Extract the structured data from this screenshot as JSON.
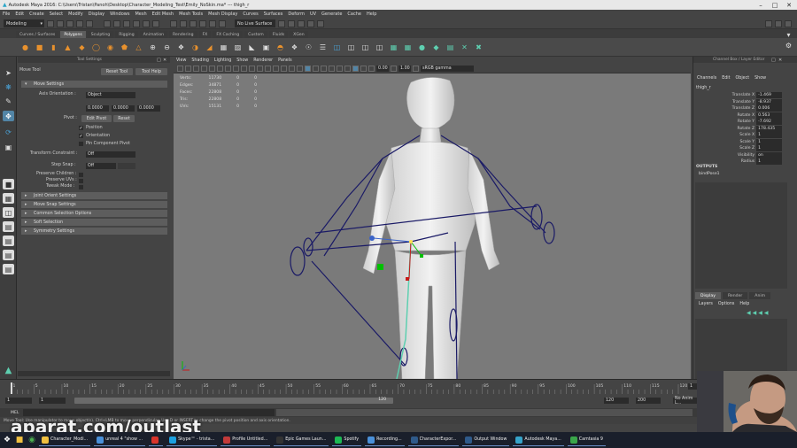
{
  "window": {
    "title": "Autodesk Maya 2016: C:\\Users\\Tristan\\Panoh\\Desktop\\Character_Modeling_Test\\Emily_NoSkin.ma*  ---  thigh_r"
  },
  "menu": [
    "File",
    "Edit",
    "Create",
    "Select",
    "Modify",
    "Display",
    "Windows",
    "Mesh",
    "Edit Mesh",
    "Mesh Tools",
    "Mesh Display",
    "Curves",
    "Surfaces",
    "Deform",
    "UV",
    "Generate",
    "Cache",
    "Help"
  ],
  "statusline": {
    "mode": "Modeling",
    "live_surface": "No Live Surface"
  },
  "shelf_tabs": [
    "Curves / Surfaces",
    "Polygons",
    "Sculpting",
    "Rigging",
    "Animation",
    "Rendering",
    "FX",
    "FX Caching",
    "Custom",
    "Fluids",
    "XGen"
  ],
  "shelf_active": "Polygons",
  "tool_settings": {
    "panel_title": "Tool Settings",
    "tool_name": "Move Tool",
    "reset_button": "Reset Tool",
    "help_button": "Tool Help",
    "move_settings": "Move Settings",
    "axis_orientation_label": "Axis Orientation :",
    "axis_orientation_value": "Object",
    "coord_x": "0.0000",
    "coord_y": "0.0000",
    "coord_z": "0.0000",
    "pivot_label": "Pivot :",
    "edit_pivot": "Edit Pivot",
    "pivot_reset": "Reset",
    "position": "Position",
    "orientation": "Orientation",
    "pin_pivot": "Pin Component Pivot",
    "transform_constraint_label": "Transform Constraint :",
    "transform_constraint_value": "Off",
    "step_snap_label": "Step Snap :",
    "step_snap_value": "Off",
    "preserve_children": "Preserve Children :",
    "preserve_uvs": "Preserve UVs :",
    "tweak_mode": "Tweak Mode :",
    "sections": [
      "Joint Orient Settings",
      "Move Snap Settings",
      "Common Selection Options",
      "Soft Selection",
      "Symmetry Settings"
    ]
  },
  "viewport": {
    "menu": [
      "View",
      "Shading",
      "Lighting",
      "Show",
      "Renderer",
      "Panels"
    ],
    "gamma": "sRGB gamma",
    "exposure": "0.00",
    "gamma_val": "1.00",
    "hud": [
      {
        "label": "Verts:",
        "a": "11730",
        "b": "0",
        "c": "0"
      },
      {
        "label": "Edges:",
        "a": "34871",
        "b": "0",
        "c": "0"
      },
      {
        "label": "Faces:",
        "a": "22808",
        "b": "0",
        "c": "0"
      },
      {
        "label": "Tris:",
        "a": "22808",
        "b": "0",
        "c": "0"
      },
      {
        "label": "UVs:",
        "a": "15131",
        "b": "0",
        "c": "0"
      }
    ]
  },
  "channel_box": {
    "header": "Channel Box / Layer Editor",
    "menu": [
      "Channels",
      "Edit",
      "Object",
      "Show"
    ],
    "object": "thigh_r",
    "channels": [
      {
        "name": "Translate X",
        "value": "-1.469"
      },
      {
        "name": "Translate Y",
        "value": "-8.937"
      },
      {
        "name": "Translate Z",
        "value": "0.006"
      },
      {
        "name": "Rotate X",
        "value": "0.563"
      },
      {
        "name": "Rotate Y",
        "value": "-7.692"
      },
      {
        "name": "Rotate Z",
        "value": "178.435"
      },
      {
        "name": "Scale X",
        "value": "1"
      },
      {
        "name": "Scale Y",
        "value": "1"
      },
      {
        "name": "Scale Z",
        "value": "1"
      },
      {
        "name": "Visibility",
        "value": "on"
      },
      {
        "name": "Radius",
        "value": "1"
      }
    ],
    "outputs_label": "OUTPUTS",
    "outputs_item": "bindPose1"
  },
  "layer_editor": {
    "tabs": [
      "Display",
      "Render",
      "Anim"
    ],
    "menu": [
      "Layers",
      "Options",
      "Help"
    ]
  },
  "timeline": {
    "ticks": [
      "1",
      "5",
      "10",
      "15",
      "20",
      "25",
      "30",
      "35",
      "40",
      "45",
      "50",
      "55",
      "60",
      "65",
      "70",
      "75",
      "80",
      "85",
      "90",
      "95",
      "100",
      "105",
      "110",
      "115",
      "120"
    ],
    "current_frame": "1",
    "range_start": "1",
    "range_start2": "1",
    "range_end_inner": "120",
    "range_end": "120",
    "range_max": "200",
    "anim_layer": "No Anim L..."
  },
  "cmdline": {
    "label": "MEL"
  },
  "help_line": "Move Tool: Use manipulator to move object(s). Ctrl+LMB to move perpendicular. Use D or INSERT to change the pivot position and axis orientation.",
  "taskbar": [
    {
      "label": "Character_Modi...",
      "color": "#f0c040"
    },
    {
      "label": "unreal 4 \"show ...",
      "color": "#4a90d9"
    },
    {
      "label": "",
      "color": "#d9342b"
    },
    {
      "label": "Skype™ - trista...",
      "color": "#1ba0e0"
    },
    {
      "label": "Profile Untitled...",
      "color": "#c23a3a"
    },
    {
      "label": "Epic Games Laun...",
      "color": "#333333"
    },
    {
      "label": "Spotify",
      "color": "#1db954"
    },
    {
      "label": "Recording...",
      "color": "#4a90d9"
    },
    {
      "label": "CharacterExpor...",
      "color": "#2f5a8a"
    },
    {
      "label": "Output Window",
      "color": "#2f5a8a"
    },
    {
      "label": "Autodesk Maya...",
      "color": "#36a3c9"
    },
    {
      "label": "Camtasia 9",
      "color": "#3aa64a"
    }
  ],
  "watermark": "aparat.com/outlast",
  "colors": {
    "accent": "#5285a6",
    "active_tab": "#5d5d5d",
    "viewport": "#7a7a7a",
    "gizmo_green": "#00c000",
    "wire": "#1a1a66"
  }
}
